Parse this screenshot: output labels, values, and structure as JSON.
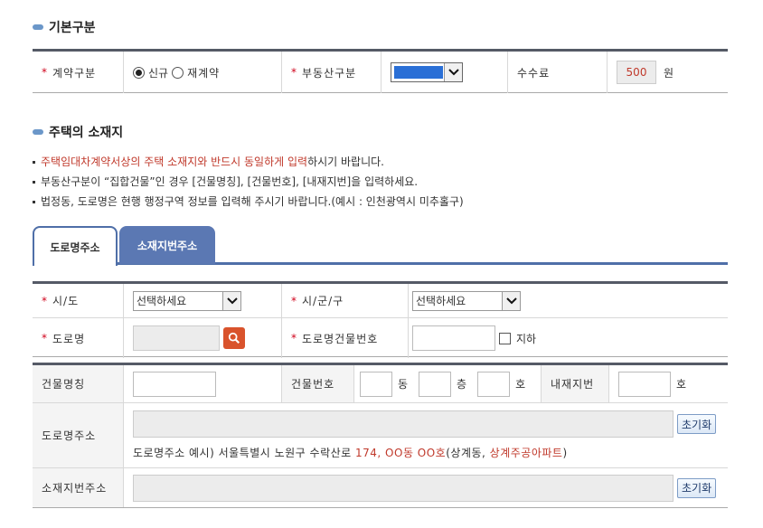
{
  "basic": {
    "title": "기본구분",
    "contract_label": "계약구분",
    "radio_new": "신규",
    "radio_renew": "재계약",
    "property_label": "부동산구분",
    "property_select_value": "",
    "fee_label": "수수료",
    "fee_value": "500",
    "fee_unit": "원"
  },
  "location": {
    "title": "주택의 소재지",
    "note1_red": "주택임대차계약서상의 주택 소재지와 반드시 동일하게 입력",
    "note1_rest": "하시기 바랍니다.",
    "note2": "부동산구분이 “집합건물”인 경우 [건물명칭], [건물번호], [내재지번]을 입력하세요.",
    "note3": "법정동, 도로명은 현행 행정구역 정보를 입력해 주시기 바랍니다.(예시 : 인천광역시 미추홀구)"
  },
  "tabs": {
    "road": "도로명주소",
    "lot": "소재지번주소"
  },
  "addr": {
    "sido_label": "시/도",
    "sido_value": "선택하세요",
    "sigungu_label": "시/군/구",
    "sigungu_value": "선택하세요",
    "road_label": "도로명",
    "road_bldg_no_label": "도로명건물번호",
    "basement_label": "지하"
  },
  "detail": {
    "bldg_name_label": "건물명칭",
    "bldg_no_label": "건물번호",
    "dong": "동",
    "floor": "층",
    "ho": "호",
    "inner_lot_label": "내재지번",
    "inner_ho": "호",
    "road_addr_label": "도로명주소",
    "reset": "초기화",
    "example_prefix": "도로명주소 예시) 서울특별시 노원구 수락산로 ",
    "example_red1": "174, OO동 OO호",
    "example_mid": "(상계동, ",
    "example_red2": "상계주공아파트",
    "example_suffix": ")",
    "lot_addr_label": "소재지번주소",
    "reset2": "초기화"
  }
}
